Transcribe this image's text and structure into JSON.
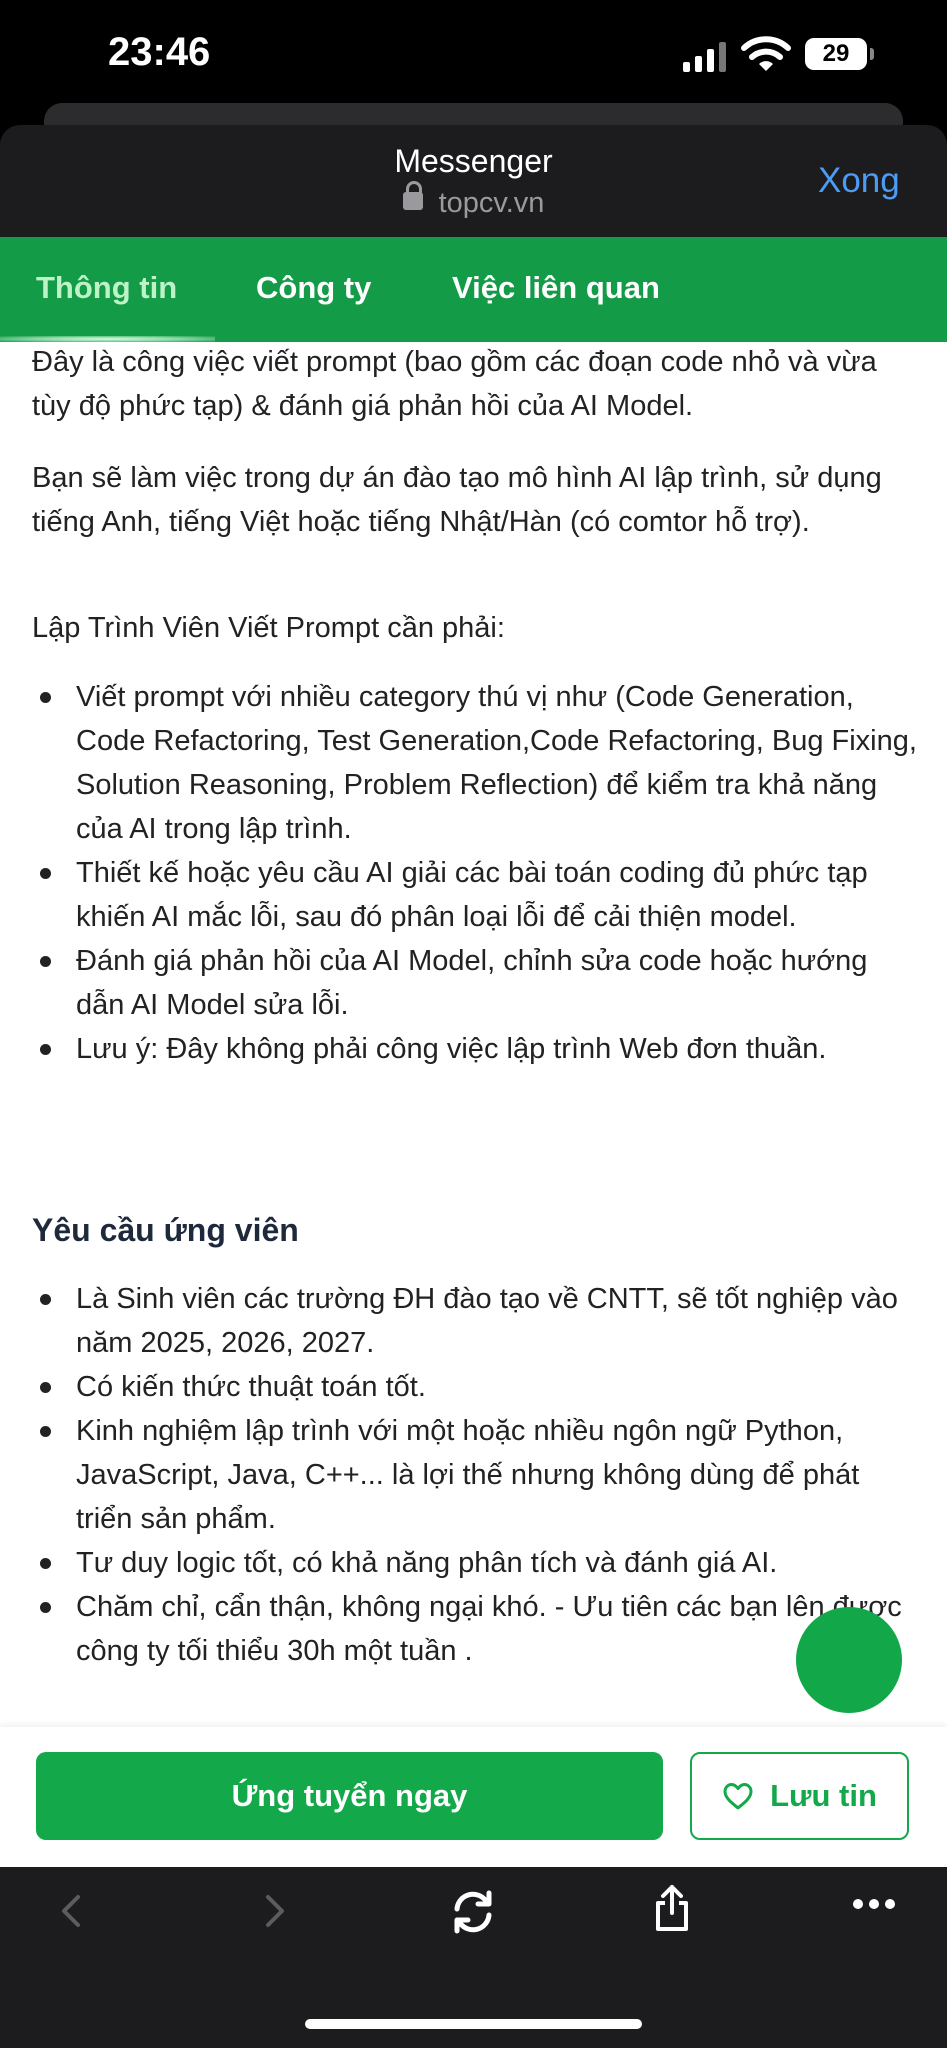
{
  "status_bar": {
    "time": "23:46",
    "battery": "29"
  },
  "header": {
    "title": "Messenger",
    "url": "topcv.vn",
    "done_label": "Xong"
  },
  "tabs": [
    {
      "label": "Thông tin",
      "active": true
    },
    {
      "label": "Công ty",
      "active": false
    },
    {
      "label": "Việc liên quan",
      "active": false
    }
  ],
  "content": {
    "intro": "Đây là công việc viết prompt (bao gồm các đoạn code nhỏ và vừa tùy độ phức tạp) & đánh giá phản hồi của AI Model.",
    "project": "Bạn sẽ làm việc trong dự án đào tạo mô hình AI lập trình, sử dụng tiếng Anh, tiếng Việt hoặc tiếng Nhật/Hàn (có comtor hỗ trợ).",
    "duties_title": "Lập Trình Viên Viết Prompt cần phải:",
    "duties": [
      "Viết prompt với nhiều category thú vị như (Code Generation, Code Refactoring, Test Generation,Code Refactoring, Bug Fixing, Solution Reasoning, Problem Reflection) để kiểm tra khả năng của AI trong lập trình.",
      "Thiết kế hoặc yêu cầu AI giải các bài toán coding đủ phức tạp khiến AI mắc lỗi, sau đó phân loại lỗi để cải thiện model.",
      "Đánh giá phản hồi của AI Model, chỉnh sửa code hoặc hướng dẫn AI Model sửa lỗi.",
      "Lưu ý: Đây không phải công việc lập trình Web đơn thuần."
    ],
    "requirements_heading": "Yêu cầu ứng viên",
    "requirements": [
      "Là Sinh viên các trường ĐH đào tạo về CNTT, sẽ tốt nghiệp vào năm 2025, 2026, 2027.",
      "Có kiến thức thuật toán tốt.",
      "Kinh nghiệm lập trình với một hoặc nhiều ngôn ngữ Python, JavaScript, Java, C++... là lợi thế nhưng không dùng để phát triển sản phẩm.",
      "Tư duy logic tốt, có khả năng phân tích và đánh giá AI.",
      "Chăm chỉ, cẩn thận, không ngại khó. - Ưu tiên các bạn lên được công ty tối thiểu 30h một tuần ."
    ]
  },
  "actions": {
    "apply_label": "Ứng tuyển ngay",
    "save_label": "Lưu tin"
  },
  "colors": {
    "brand_green": "#139b48",
    "link_blue": "#4b9cf5"
  }
}
